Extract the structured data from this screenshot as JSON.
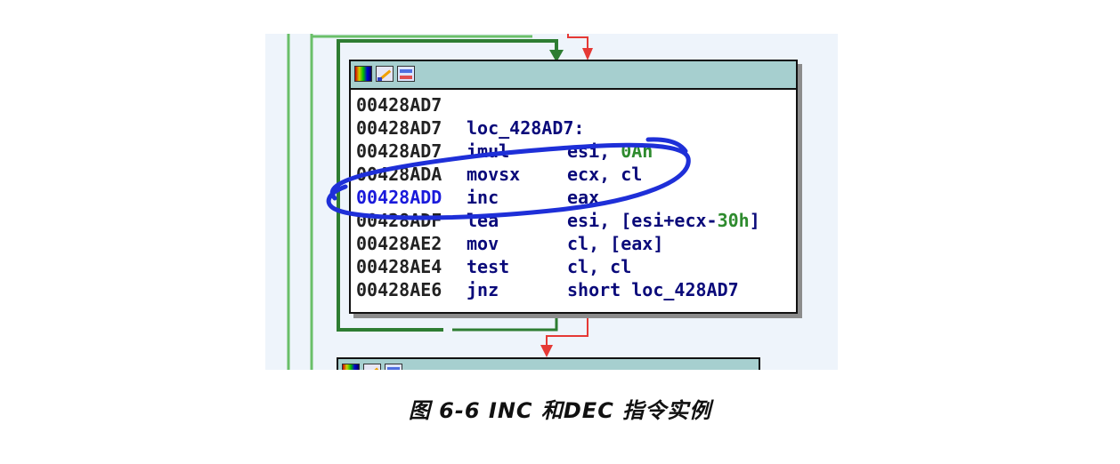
{
  "block": {
    "icons": [
      "color-palette-icon",
      "edit-pencil-icon",
      "graph-view-icon"
    ],
    "lines": [
      {
        "addr": "00428AD7",
        "mnemonic": "",
        "operands": ""
      },
      {
        "addr": "00428AD7",
        "label": "loc_428AD7:"
      },
      {
        "addr": "00428AD7",
        "mnemonic": "imul",
        "operands_pre": "esi, ",
        "operands_num": "0Ah",
        "operands_post": ""
      },
      {
        "addr": "00428ADA",
        "mnemonic": "movsx",
        "operands_pre": "ecx, cl",
        "operands_num": "",
        "operands_post": ""
      },
      {
        "addr": "00428ADD",
        "mnemonic": "inc",
        "operands_pre": "eax",
        "operands_num": "",
        "operands_post": "",
        "selected": true
      },
      {
        "addr": "00428ADF",
        "mnemonic": "lea",
        "operands_pre": "esi, [esi+ecx-",
        "operands_num": "30h",
        "operands_post": "]"
      },
      {
        "addr": "00428AE2",
        "mnemonic": "mov",
        "operands_pre": "cl, [eax]",
        "operands_num": "",
        "operands_post": ""
      },
      {
        "addr": "00428AE4",
        "mnemonic": "test",
        "operands_pre": "cl, cl",
        "operands_num": "",
        "operands_post": ""
      },
      {
        "addr": "00428AE6",
        "mnemonic": "jnz",
        "operands_pre": "short loc_428AD7",
        "operands_num": "",
        "operands_post": ""
      }
    ]
  },
  "caption": "图 6-6  INC 和DEC 指令实例",
  "colors": {
    "true_edge": "#2e7d32",
    "false_edge": "#e53935",
    "loop_edge": "#6abf69",
    "annotation": "#1e2fd8",
    "titlebar": "#a6cfcf"
  }
}
